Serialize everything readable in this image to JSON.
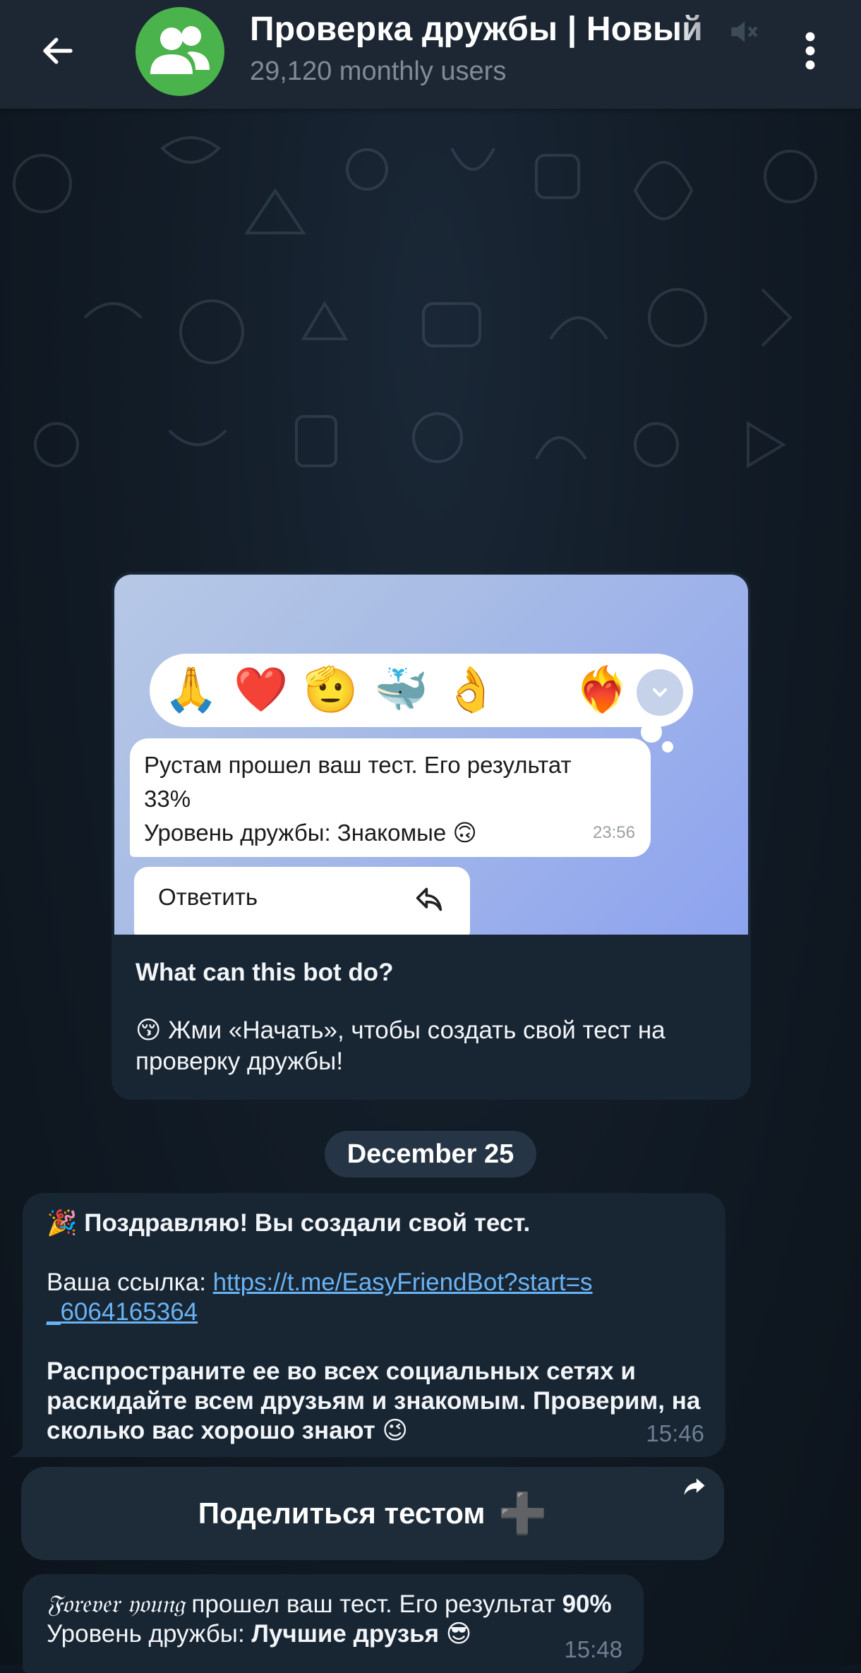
{
  "header": {
    "title": "Проверка дружбы | Новый",
    "subtitle": "29,120 monthly users",
    "back_icon": "arrow-left-icon",
    "avatar_icon": "users-icon",
    "mute_icon": "mute-icon",
    "menu_icon": "more-vertical-icon"
  },
  "intro": {
    "preview": {
      "reactions": [
        "🙏",
        "❤️",
        "🫡",
        "🐳",
        "👌",
        "😁",
        "❤️‍🔥"
      ],
      "message_line1": "Рустам прошел ваш тест. Его результат",
      "message_line2": "33%",
      "message_line3": "Уровень дружбы: Знакомые 🙃",
      "message_time": "23:56",
      "reply_label": "Ответить"
    },
    "heading": "What can this bot do?",
    "text": "😚 Жми «Начать», чтобы создать свой тест на проверку дружбы!"
  },
  "date_chip": "December 25",
  "message1": {
    "line1": "🎉 Поздравляю! Вы создали свой тест.",
    "link_prefix": "Ваша ссылка: ",
    "link_line1": "https://t.me/EasyFriendBot?start=s",
    "link_line2": "_6064165364",
    "p3_line1": "Распространите ее во всех социальных сетях и",
    "p3_line2": "раскидайте всем друзьям и знакомым. Проверим, на",
    "p3_line3": "сколько вас хорошо знают 😉",
    "time": "15:46"
  },
  "share_button": {
    "label": "Поделиться тестом",
    "plus": "➕",
    "corner_icon": "share-arrow-icon"
  },
  "message2": {
    "name": "𝔉𝔬𝔯𝔢𝔳𝔢𝔯 𝔶𝔬𝔲𝔫𝔤",
    "text1": " прошел ваш тест. Его результат ",
    "result": "90%",
    "level_prefix": "Уровень дружбы: ",
    "level": "Лучшие друзья 😎",
    "time": "15:48"
  },
  "colors": {
    "header_bg": "#1c2733",
    "bubble_bg": "#182533",
    "link": "#6ab3f3",
    "avatar": "#4bb34b",
    "subtitle": "#7f8b97"
  }
}
